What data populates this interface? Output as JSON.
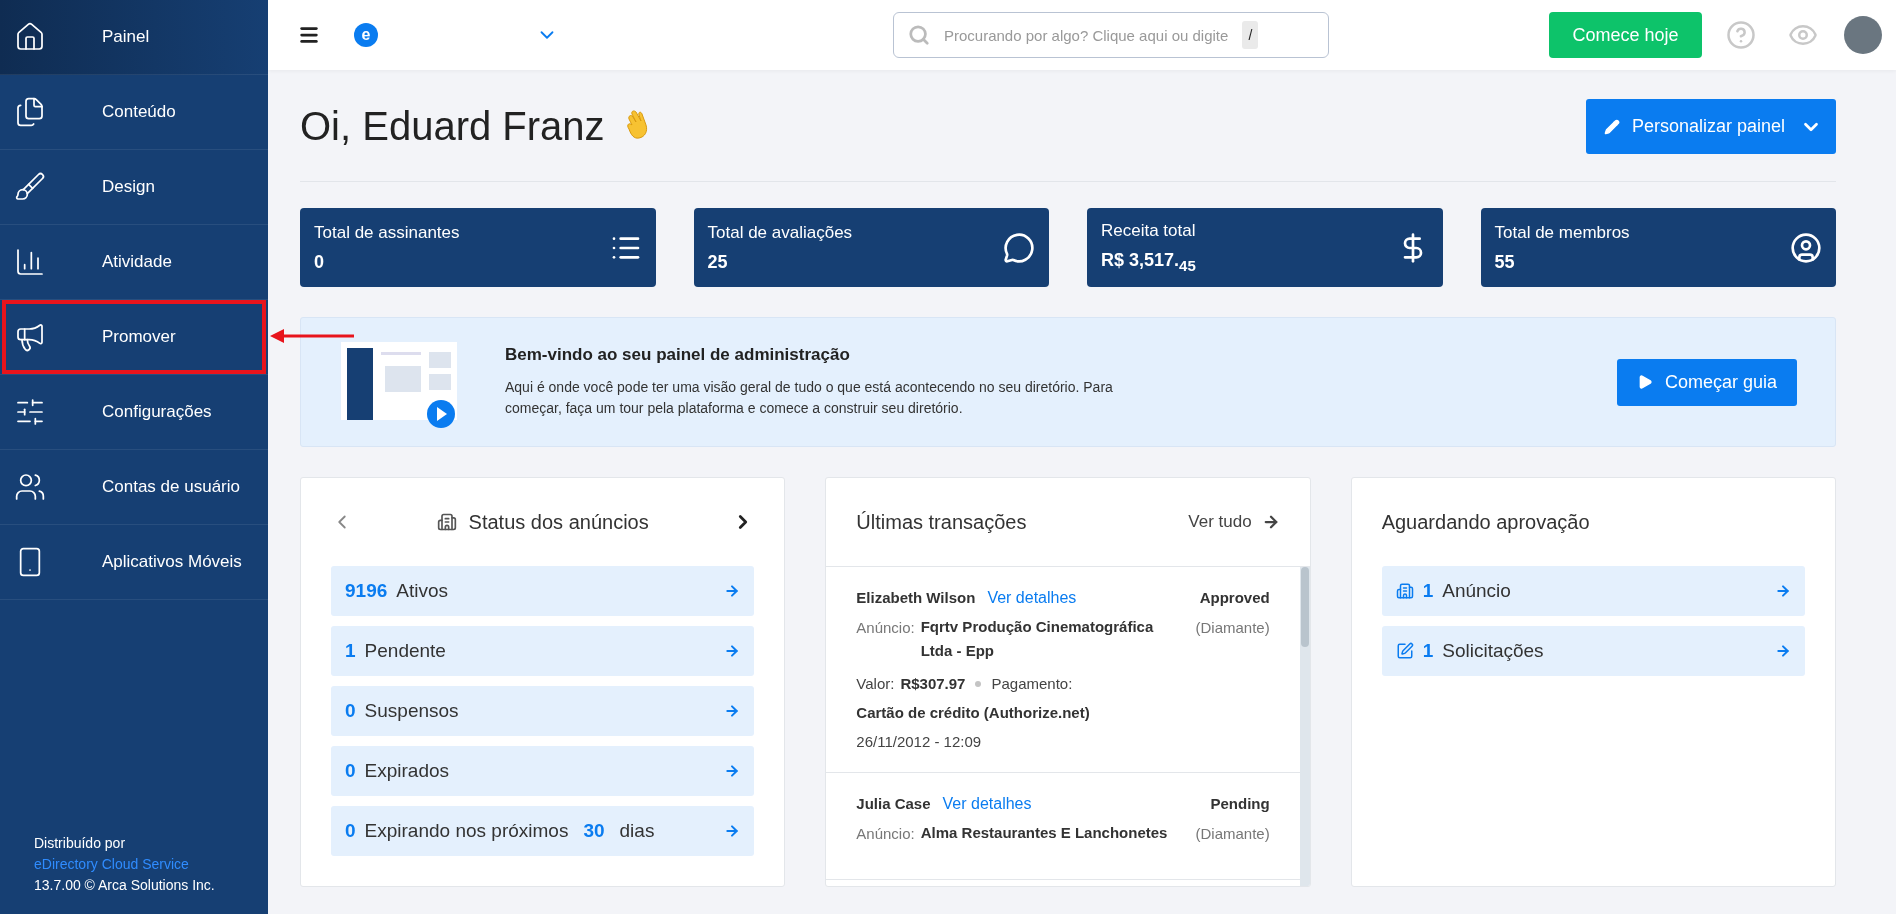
{
  "sidebar": {
    "items": [
      {
        "label": "Painel",
        "selected": true,
        "annotated": false
      },
      {
        "label": "Conteúdo",
        "selected": false,
        "annotated": false
      },
      {
        "label": "Design",
        "selected": false,
        "annotated": false
      },
      {
        "label": "Atividade",
        "selected": false,
        "annotated": false
      },
      {
        "label": "Promover",
        "selected": false,
        "annotated": true
      },
      {
        "label": "Configurações",
        "selected": false,
        "annotated": false
      },
      {
        "label": "Contas de usuário",
        "selected": false,
        "annotated": false
      },
      {
        "label": "Aplicativos Móveis",
        "selected": false,
        "annotated": false
      }
    ],
    "footer": {
      "line_1": "Distribuído por",
      "link": "eDirectory Cloud Service",
      "line_3": "13.7.00 © Arca Solutions Inc."
    }
  },
  "topbar": {
    "logo": "e",
    "search": {
      "placeholder": "Procurando por algo? Clique aqui ou digite",
      "shortcut": "/"
    },
    "cta": "Comece hoje"
  },
  "header": {
    "greeting": "Oi, Eduard Franz",
    "customize_button": "Personalizar painel"
  },
  "stats": [
    {
      "label": "Total de assinantes",
      "value": "0"
    },
    {
      "label": "Total de avaliações",
      "value": "25"
    },
    {
      "label": "Receita total",
      "value": "R$ 3,517.$_{45}$"
    },
    {
      "label": "Total de membros",
      "value": "55"
    }
  ],
  "welcome": {
    "title": "Bem-vindo ao seu painel de administração",
    "text": "Aqui é onde você pode ter uma visão geral de tudo o que está acontecendo no seu diretório. Para começar, faça um tour pela plataforma e comece a construir seu diretório.",
    "button": "Começar guia"
  },
  "listing_status": {
    "title": "Status dos anúncios",
    "rows": [
      {
        "count": "9196",
        "label": "Ativos"
      },
      {
        "count": "1",
        "label": "Pendente"
      },
      {
        "count": "0",
        "label": "Suspensos"
      },
      {
        "count": "0",
        "label": "Expirados"
      },
      {
        "count": "0",
        "label": "Expirando nos próximos",
        "days": "30",
        "suffix": "dias"
      }
    ]
  },
  "transactions": {
    "title": "Últimas transações",
    "view_all": "Ver tudo",
    "items": [
      {
        "name": "Elizabeth Wilson",
        "link": "Ver detalhes",
        "status": "Approved",
        "listing_label": "Anúncio:",
        "listing": "Fqrtv Produção Cinematográfica Ltda - Epp",
        "level": "(Diamante)",
        "amount_label": "Valor:",
        "amount": "R$307.97",
        "payment_label": "Pagamento:",
        "payment": "Cartão de crédito (Authorize.net)",
        "date": "26/11/2012 - 12:09"
      },
      {
        "name": "Julia Case",
        "link": "Ver detalhes",
        "status": "Pending",
        "listing_label": "Anúncio:",
        "listing": "Alma Restaurantes E Lanchonetes",
        "level": "(Diamante)"
      }
    ]
  },
  "approval": {
    "title": "Aguardando aprovação",
    "rows": [
      {
        "count": "1",
        "label": "Anúncio"
      },
      {
        "count": "1",
        "label": "Solicitações"
      }
    ]
  }
}
